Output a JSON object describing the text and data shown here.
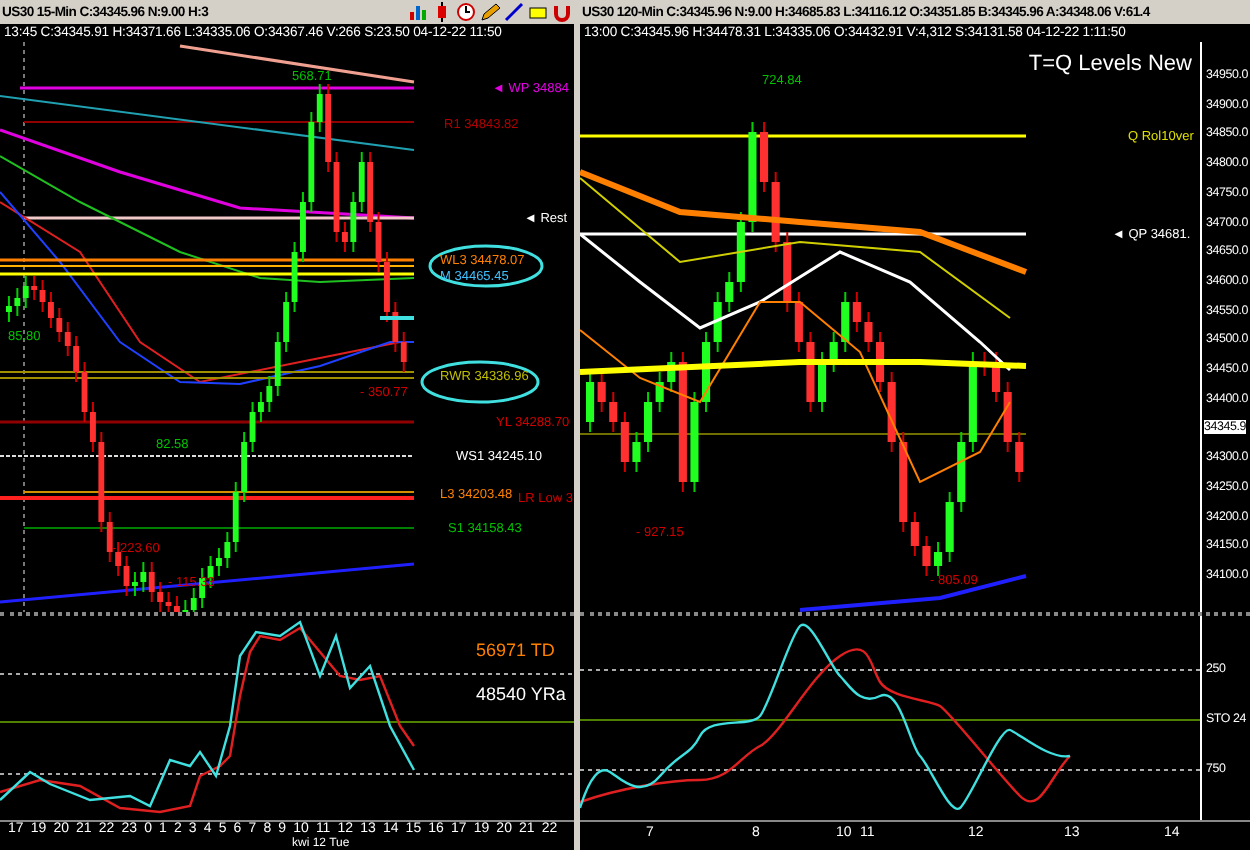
{
  "left_chart": {
    "title_bar": "US30 15-Min C:34345.96 N:9.00 H:3",
    "info_line": "13:45 C:34345.91 H:34371.66 L:34335.06 O:34367.46 V:266 S:23.50 04-12-22 11:50",
    "level_labels": [
      {
        "text": "568.71",
        "color": "#00c000"
      },
      {
        "text": "◄ WP 34884",
        "color": "#e000e0"
      },
      {
        "text": "R1 34843.82",
        "color": "#b00000"
      },
      {
        "text": "◄ Rest",
        "color": "#ffffff"
      },
      {
        "text": "WL3 34478.07",
        "color": "#ff8000"
      },
      {
        "text": "M 34465.45",
        "color": "#40c0ff"
      },
      {
        "text": "85.80",
        "color": "#00c000"
      },
      {
        "text": "RWR 34336.96",
        "color": "#c0c000"
      },
      {
        "text": "- 350.77",
        "color": "#d00000"
      },
      {
        "text": "YL 34288.70",
        "color": "#d00000"
      },
      {
        "text": "82.58",
        "color": "#00c000"
      },
      {
        "text": "WS1 34245.10",
        "color": "#ffffff"
      },
      {
        "text": "L3 34203.48",
        "color": "#ff8000"
      },
      {
        "text": "LR Low 3",
        "color": "#d00000"
      },
      {
        "text": "S1 34158.43",
        "color": "#00c000"
      },
      {
        "text": "- 223.60",
        "color": "#d00000"
      },
      {
        "text": "- 115.33",
        "color": "#d00000"
      }
    ],
    "oscillator_labels": [
      {
        "text": "56971 TD",
        "color": "#ff8000"
      },
      {
        "text": "48540 YRa",
        "color": "#ffffff"
      }
    ],
    "x_axis_labels": [
      "17",
      "19",
      "20",
      "21",
      "22",
      "23",
      "0",
      "1",
      "2",
      "3",
      "4",
      "5",
      "6",
      "7",
      "8",
      "9",
      "10",
      "11",
      "12",
      "13",
      "14",
      "15",
      "16",
      "17",
      "19",
      "20",
      "21",
      "22"
    ],
    "date_label": "kwi 12 Tue"
  },
  "right_chart": {
    "title_bar": "US30 120-Min C:34345.96 N:9.00 H:34685.83 L:34116.12 O:34351.85 B:34345.96 A:34348.06 V:61.4",
    "info_line": "13:00 C:34345.96 H:34478.31 L:34335.06 O:34432.91 V:4,312 S:34131.58 04-12-22 1:11:50",
    "chart_title": "T=Q Levels New",
    "level_labels": [
      {
        "text": "724.84",
        "color": "#00c000"
      },
      {
        "text": "Q Rol10ver",
        "color": "#e0e000"
      },
      {
        "text": "◄ QP 34681.",
        "color": "#ffffff"
      },
      {
        "text": "- 927.15",
        "color": "#d00000"
      },
      {
        "text": "- 805.09",
        "color": "#d00000"
      }
    ],
    "y_axis_labels": [
      "34950.0",
      "34900.0",
      "34850.0",
      "34800.0",
      "34750.0",
      "34700.0",
      "34650.0",
      "34600.0",
      "34550.0",
      "34500.0",
      "34450.0",
      "34400.0",
      "34300.0",
      "34250.0",
      "34200.0",
      "34150.0",
      "34100.0"
    ],
    "price_tag": "34345.9",
    "oscillator_labels": [
      "250",
      "STO 24",
      "750"
    ],
    "x_axis_labels": [
      "7",
      "8",
      "10",
      "11",
      "12",
      "13",
      "14"
    ]
  }
}
